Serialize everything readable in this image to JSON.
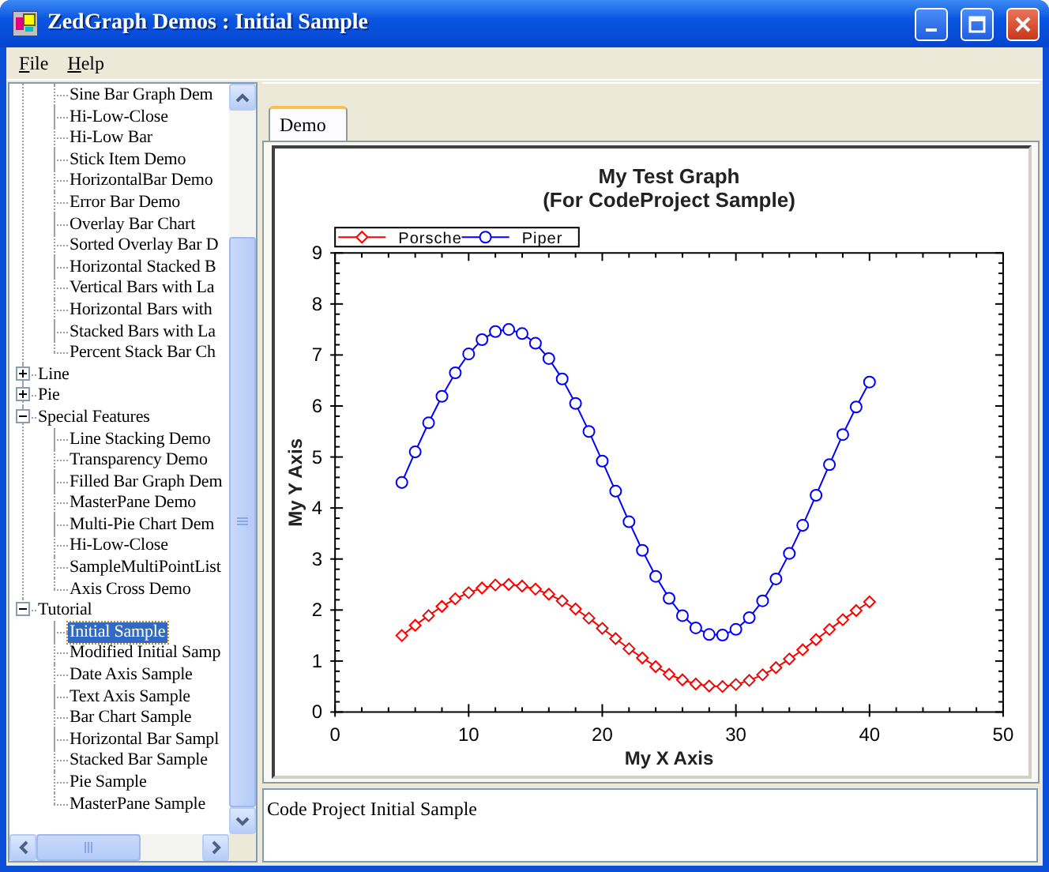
{
  "window": {
    "title": "ZedGraph Demos : Initial Sample"
  },
  "menu": [
    {
      "label": "File"
    },
    {
      "label": "Help"
    }
  ],
  "tree": {
    "items": [
      {
        "children": [
          {
            "label": "Sine Bar Graph Dem",
            "selected": false
          },
          {
            "label": "Hi-Low-Close",
            "selected": false
          },
          {
            "label": "Hi-Low Bar",
            "selected": false
          },
          {
            "label": "Stick Item Demo",
            "selected": false
          },
          {
            "label": "HorizontalBar Demo",
            "selected": false
          },
          {
            "label": "Error Bar Demo",
            "selected": false
          },
          {
            "label": "Overlay Bar Chart",
            "selected": false
          },
          {
            "label": "Sorted Overlay Bar D",
            "selected": false
          },
          {
            "label": "Horizontal Stacked B",
            "selected": false
          },
          {
            "label": "Vertical Bars with La",
            "selected": false
          },
          {
            "label": "Horizontal Bars with",
            "selected": false
          },
          {
            "label": "Stacked Bars with La",
            "selected": false
          },
          {
            "label": "Percent Stack Bar Ch",
            "selected": false
          }
        ]
      },
      {
        "label": "Line",
        "selected": false,
        "expanded": false
      },
      {
        "label": "Pie",
        "selected": false,
        "expanded": false
      },
      {
        "label": "Special Features",
        "selected": false,
        "expanded": true,
        "children": [
          {
            "label": "Line Stacking Demo",
            "selected": false
          },
          {
            "label": "Transparency Demo",
            "selected": false
          },
          {
            "label": "Filled Bar Graph Dem",
            "selected": false
          },
          {
            "label": "MasterPane Demo",
            "selected": false
          },
          {
            "label": "Multi-Pie Chart Dem",
            "selected": false
          },
          {
            "label": "Hi-Low-Close",
            "selected": false
          },
          {
            "label": "SampleMultiPointList",
            "selected": false
          },
          {
            "label": "Axis Cross Demo",
            "selected": false
          }
        ]
      },
      {
        "label": "Tutorial",
        "selected": false,
        "expanded": true,
        "children": [
          {
            "label": "Initial Sample",
            "selected": true
          },
          {
            "label": "Modified Initial Samp",
            "selected": false
          },
          {
            "label": "Date Axis Sample",
            "selected": false
          },
          {
            "label": "Text Axis Sample",
            "selected": false
          },
          {
            "label": "Bar Chart Sample",
            "selected": false
          },
          {
            "label": "Horizontal Bar Sampl",
            "selected": false
          },
          {
            "label": "Stacked Bar Sample",
            "selected": false
          },
          {
            "label": "Pie Sample",
            "selected": false
          },
          {
            "label": "MasterPane Sample",
            "selected": false
          }
        ]
      }
    ]
  },
  "tabs": [
    {
      "label": "Demo",
      "selected": true
    }
  ],
  "graph": {
    "chart_data": {
      "type": "line",
      "title": "My Test Graph\n(For CodeProject Sample)",
      "xlabel": "My X Axis",
      "ylabel": "My Y Axis",
      "x": [
        5,
        6,
        7,
        8,
        9,
        10,
        11,
        12,
        13,
        14,
        15,
        16,
        17,
        18,
        19,
        20,
        21,
        22,
        23,
        24,
        25,
        26,
        27,
        28,
        29,
        30,
        31,
        32,
        33,
        34,
        35,
        36,
        37,
        38,
        39,
        40
      ],
      "series": [
        {
          "name": "Porsche",
          "color": "#ff0000",
          "marker": "diamond",
          "values": [
            1.5,
            1.7,
            1.89,
            2.07,
            2.22,
            2.34,
            2.43,
            2.49,
            2.5,
            2.47,
            2.41,
            2.31,
            2.18,
            2.02,
            1.84,
            1.64,
            1.44,
            1.24,
            1.06,
            0.89,
            0.74,
            0.63,
            0.55,
            0.51,
            0.5,
            0.54,
            0.62,
            0.73,
            0.87,
            1.04,
            1.22,
            1.42,
            1.62,
            1.81,
            1.99,
            2.16
          ]
        },
        {
          "name": "Piper",
          "color": "#0000ff",
          "marker": "circle",
          "values": [
            4.5,
            5.1,
            5.67,
            6.19,
            6.65,
            7.02,
            7.3,
            7.46,
            7.5,
            7.42,
            7.23,
            6.93,
            6.53,
            6.05,
            5.5,
            4.92,
            4.33,
            3.73,
            3.17,
            2.66,
            2.23,
            1.89,
            1.65,
            1.52,
            1.51,
            1.62,
            1.85,
            2.18,
            2.61,
            3.11,
            3.66,
            4.25,
            4.85,
            5.44,
            5.98,
            6.47
          ]
        }
      ],
      "legend": true,
      "xlim": [
        0,
        50
      ],
      "ylim": [
        0,
        9
      ],
      "xticks": [
        0,
        10,
        20,
        30,
        40,
        50
      ],
      "yticks": [
        0,
        1,
        2,
        3,
        4,
        5,
        6,
        7,
        8,
        9
      ]
    }
  },
  "description": {
    "value": "Code Project Initial Sample"
  }
}
